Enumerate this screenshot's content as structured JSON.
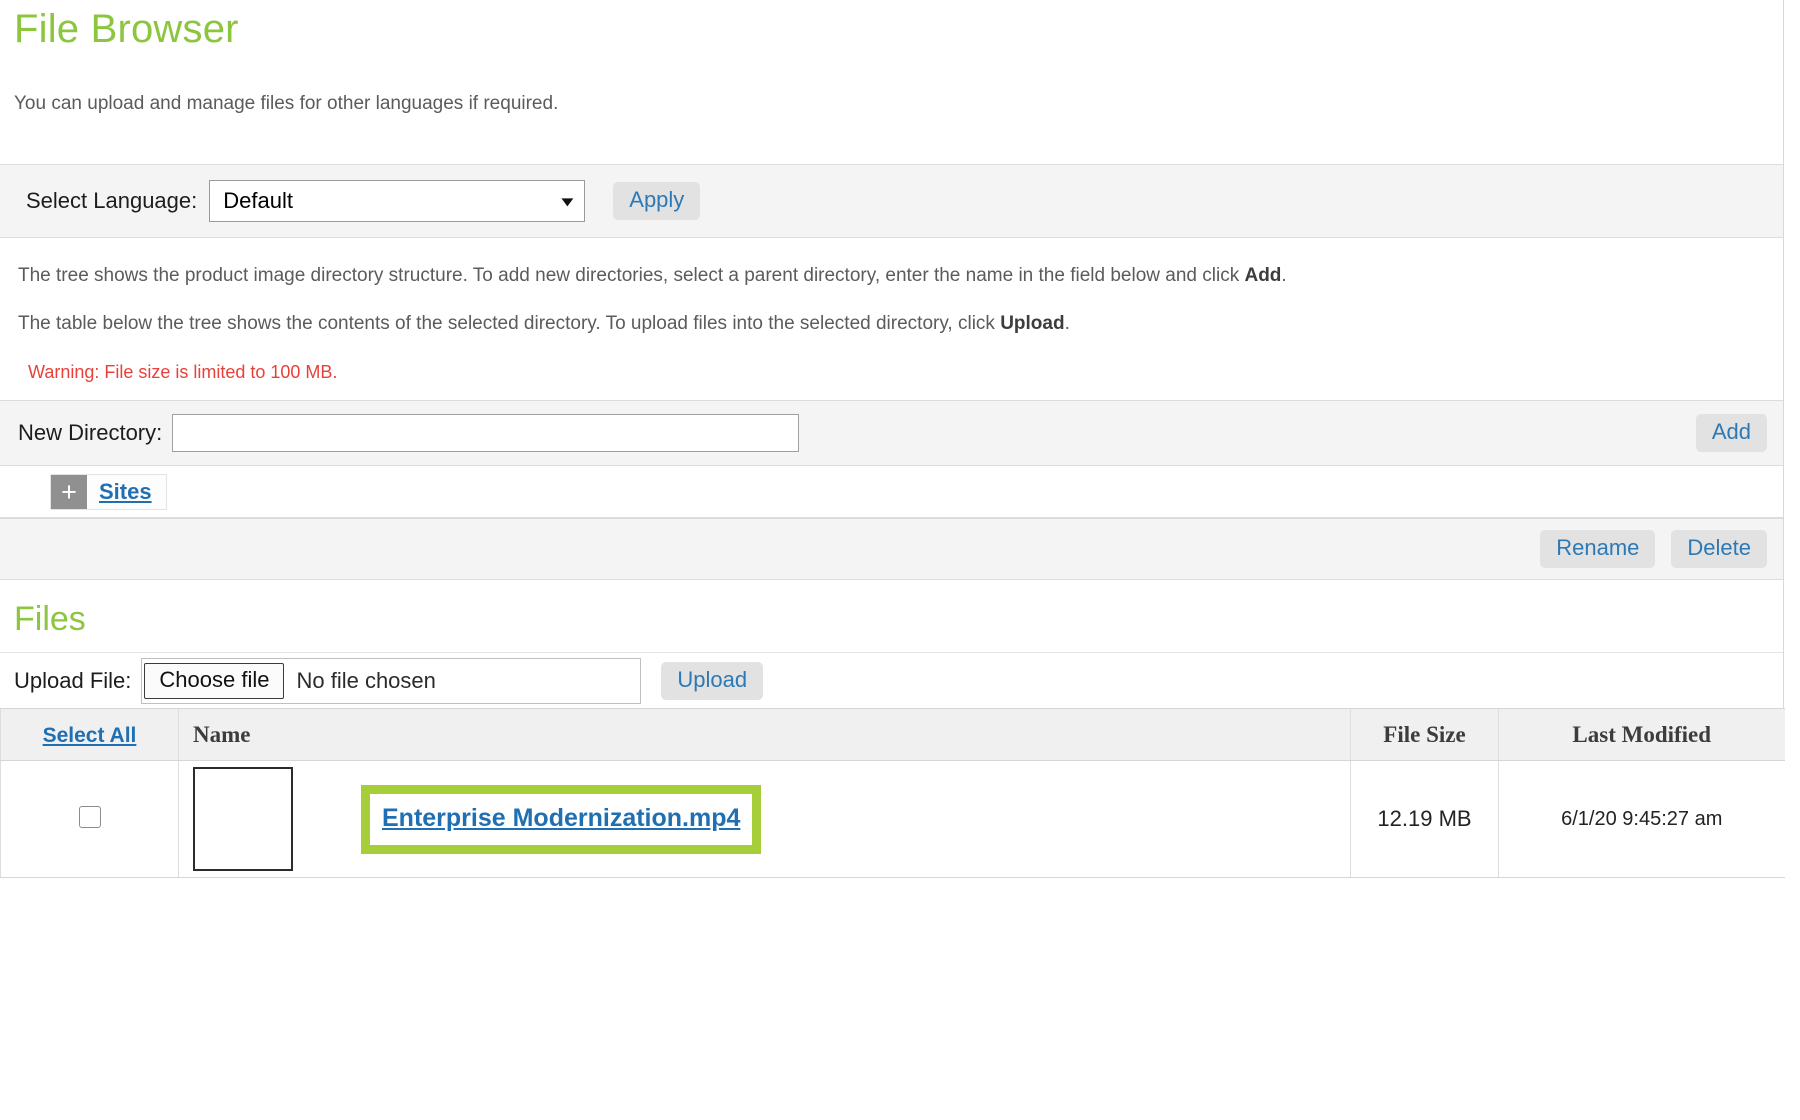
{
  "header": {
    "title": "File Browser",
    "description": "You can upload and manage files for other languages if required."
  },
  "language_row": {
    "label": "Select Language:",
    "selected_value": "Default",
    "options": [
      "Default"
    ],
    "chevron": "chevron-down-icon",
    "apply_label": "Apply"
  },
  "instructions": {
    "line1_part1": "The tree shows the product image directory structure. To add new directories, select a parent directory, enter the name in the field below and click ",
    "line1_bold": "Add",
    "line1_part2": ".",
    "line2_part1": "The table below the tree shows the contents of the selected directory. To upload files into the selected directory, click ",
    "line2_bold": "Upload",
    "line2_part2": ".",
    "warning": "Warning: File size is limited to 100 MB.",
    "warning_color": "#e8403a"
  },
  "new_directory": {
    "label": "New Directory:",
    "value": "",
    "placeholder": "",
    "add_label": "Add"
  },
  "tree": {
    "toggle_glyph": "+",
    "node_label": "Sites"
  },
  "tree_actions": {
    "rename_label": "Rename",
    "delete_label": "Delete"
  },
  "files_section": {
    "title": "Files",
    "upload_label": "Upload File:",
    "choose_file_label": "Choose file",
    "no_file_text": "No file chosen",
    "upload_button_label": "Upload"
  },
  "files_table": {
    "columns": {
      "select_all": "Select All",
      "name": "Name",
      "file_size": "File Size",
      "last_modified": "Last Modified"
    },
    "rows": [
      {
        "checked": false,
        "thumbnail": "empty-thumbnail",
        "name": "Enterprise Modernization.mp4",
        "file_size": "12.19 MB",
        "last_modified": "6/1/20 9:45:27 am",
        "highlighted": true
      }
    ]
  },
  "colors": {
    "heading_green": "#8cc63e",
    "link_blue": "#1f6fb2",
    "highlight_green": "#a6ce39",
    "button_grey": "#e2e2e2"
  }
}
